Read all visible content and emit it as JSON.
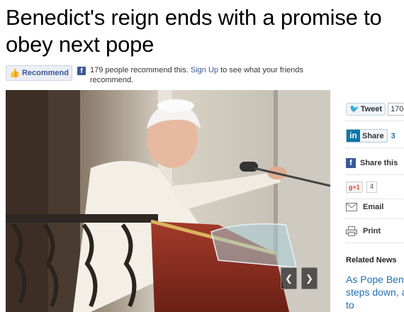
{
  "article": {
    "headline": "Benedict's reign ends with a promise to obey next pope"
  },
  "facebook": {
    "recommend_label": "Recommend",
    "recommend_text_before": "179 people recommend this.",
    "signup_label": "Sign Up",
    "recommend_text_after": "to see what your friends recommend.",
    "logo_glyph": "f"
  },
  "photo": {
    "prev_label": "❮",
    "next_label": "❯"
  },
  "share": {
    "tweet_label": "Tweet",
    "tweet_count": "170",
    "linkedin_logo": "in",
    "linkedin_label": "Share",
    "linkedin_count": "3",
    "facebook_logo": "f",
    "facebook_label": "Share this",
    "gplus_label": "g+1",
    "gplus_count": "4",
    "email_label": "Email",
    "print_label": "Print"
  },
  "related": {
    "title": "Related News",
    "link_text": "As Pope Benedict steps down, asks U.N. to"
  },
  "colors": {
    "facebook_blue": "#3b5998",
    "link_blue": "#1f6fb5",
    "twitter_blue": "#2aa9e0",
    "linkedin_blue": "#0e76a8"
  }
}
